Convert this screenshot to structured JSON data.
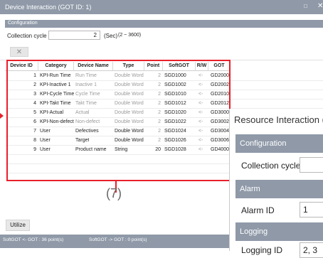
{
  "window": {
    "title": "Device Interaction (GOT ID: 1)",
    "maximize_glyph": "□",
    "close_glyph": "✕"
  },
  "configuration": {
    "header": "Configuration",
    "collection_cycle_label": "Collection cycle",
    "collection_cycle_value": "2",
    "unit": "(Sec)",
    "range": "(2 ~ 3600)"
  },
  "toolbar": {
    "delete_glyph": "✕"
  },
  "table": {
    "columns": [
      "Device ID",
      "Category",
      "Device Name",
      "Type",
      "Point",
      "SoftGOT",
      "R/W",
      "GOT"
    ],
    "rows": [
      {
        "device_id": "1",
        "category": "KPI-Run Time",
        "device_name": "Run Time",
        "type": "Double Word",
        "point": "2",
        "softgot": "SGD1000",
        "rw": "<-",
        "got": "GD2000"
      },
      {
        "device_id": "2",
        "category": "KPI-Inactive 1",
        "device_name": "Inactive 1",
        "type": "Double Word",
        "point": "2",
        "softgot": "SGD1002",
        "rw": "<-",
        "got": "GD2002"
      },
      {
        "device_id": "3",
        "category": "KPI-Cycle Time",
        "device_name": "Cycle Time",
        "type": "Double Word",
        "point": "2",
        "softgot": "SGD1010",
        "rw": "<-",
        "got": "GD2010"
      },
      {
        "device_id": "4",
        "category": "KPI-Takt Time",
        "device_name": "Takt Time",
        "type": "Double Word",
        "point": "2",
        "softgot": "SGD1012",
        "rw": "<-",
        "got": "GD2012"
      },
      {
        "device_id": "5",
        "category": "KPI-Actual",
        "device_name": "Actual",
        "type": "Double Word",
        "point": "2",
        "softgot": "SGD1020",
        "rw": "<-",
        "got": "GD3000"
      },
      {
        "device_id": "6",
        "category": "KPI-Non-defect",
        "device_name": "Non-defect",
        "type": "Double Word",
        "point": "2",
        "softgot": "SGD1022",
        "rw": "<-",
        "got": "GD3002"
      },
      {
        "device_id": "7",
        "category": "User",
        "device_name": "Defectives",
        "type": "Double Word",
        "point": "2",
        "softgot": "SGD1024",
        "rw": "<-",
        "got": "GD3004"
      },
      {
        "device_id": "8",
        "category": "User",
        "device_name": "Target",
        "type": "Double Word",
        "point": "2",
        "softgot": "SGD1026",
        "rw": "<-",
        "got": "GD3006"
      },
      {
        "device_id": "9",
        "category": "User",
        "device_name": "Product name",
        "type": "String",
        "point": "20",
        "softgot": "SGD1028",
        "rw": "<-",
        "got": "GD4000"
      }
    ]
  },
  "annotation": {
    "label": "(7)",
    "color": "#e8202a"
  },
  "buttons": {
    "utilize": "Utilize"
  },
  "status_bar": {
    "got_to_softgot": "SoftGOT <- GOT :  36 point(s)",
    "softgot_to_got": "SoftGOT -> GOT :  0 point(s)"
  },
  "overlay": {
    "title": "Resource Interaction (",
    "configuration_header": "Configuration",
    "collection_cycle_label": "Collection cycle",
    "alarm_header": "Alarm",
    "alarm_id_label": "Alarm ID",
    "alarm_id_value": "1",
    "logging_header": "Logging",
    "logging_id_label": "Logging ID",
    "logging_id_value": "2, 3"
  },
  "colors": {
    "header_bar": "#8f99a8",
    "callout": "#e8202a"
  }
}
